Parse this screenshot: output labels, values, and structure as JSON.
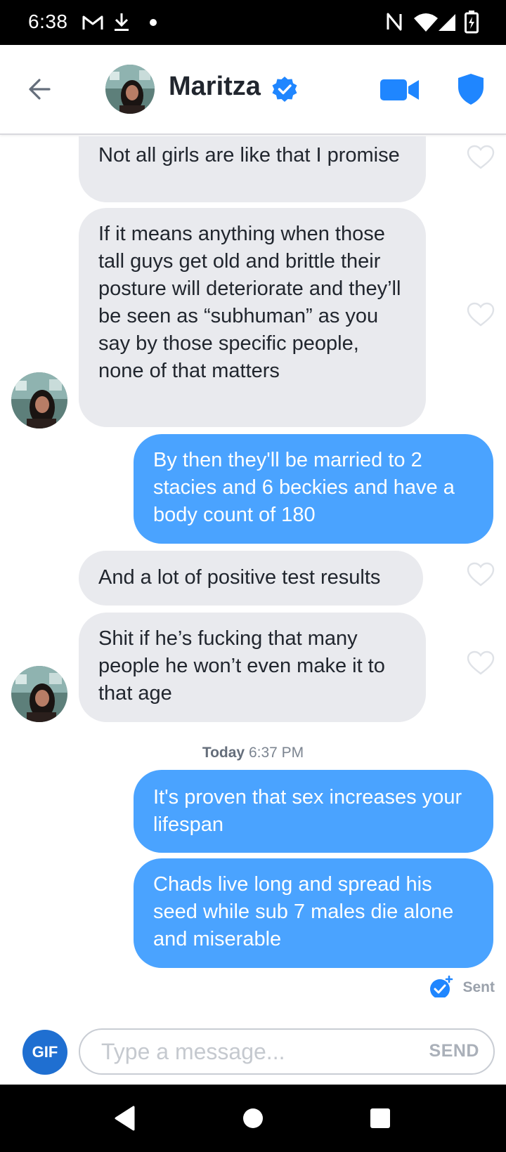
{
  "status_bar": {
    "time": "6:38",
    "icons": [
      "gmail-icon",
      "download-icon",
      "dot-icon",
      "nfc-icon",
      "wifi-icon",
      "signal-icon",
      "battery-icon"
    ]
  },
  "header": {
    "contact_name": "Maritza",
    "verified": true,
    "icons": [
      "back-arrow-icon",
      "verified-badge-icon",
      "video-call-icon",
      "safety-shield-icon"
    ]
  },
  "conversation": {
    "messages": [
      {
        "direction": "incoming",
        "text": "Not all girls are like that I promise"
      },
      {
        "direction": "incoming",
        "text": "If it means anything when those tall guys get old and brittle their posture will deteriorate and they’ll be seen as “subhuman” as you say by those specific people, none of that matters"
      },
      {
        "direction": "outgoing",
        "text": "By then they'll be married to 2 stacies and 6 beckies and have a body count of 180"
      },
      {
        "direction": "incoming",
        "text": "And a lot of positive test results"
      },
      {
        "direction": "incoming",
        "text": "Shit if he’s fucking that many people he won’t even make it to that age"
      },
      {
        "direction": "outgoing",
        "text": "It's proven that sex increases your lifespan"
      },
      {
        "direction": "outgoing",
        "text": "Chads live long and spread his seed while sub 7 males die alone and miserable"
      }
    ],
    "timestamp_day": "Today",
    "timestamp_time": "6:37 PM",
    "sent_label": "Sent"
  },
  "composer": {
    "gif_label": "GIF",
    "placeholder": "Type a message...",
    "send_label": "SEND"
  },
  "colors": {
    "outgoing_bubble": "#4aa3ff",
    "incoming_bubble": "#e9eaee",
    "brand_blue": "#1f86ff",
    "gif_button": "#1f6fd1"
  }
}
